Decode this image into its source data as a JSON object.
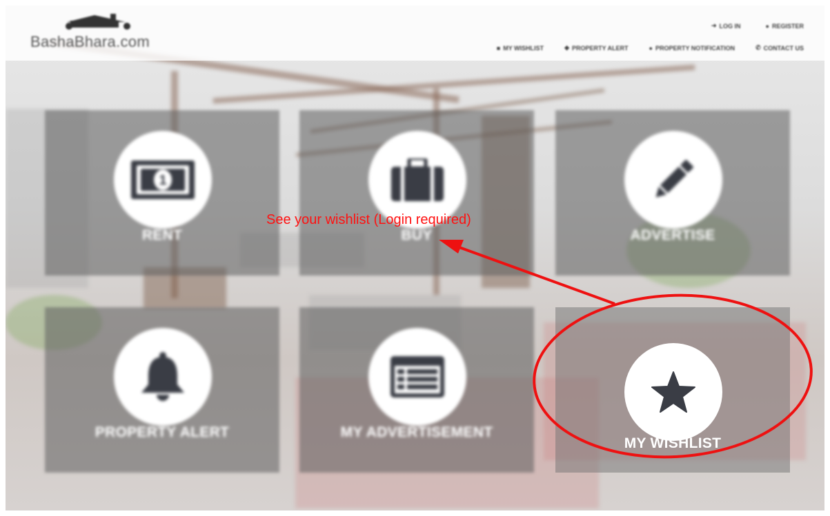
{
  "header": {
    "logo_text": "BashaBhara.com",
    "top_links": [
      {
        "label": "LOG IN",
        "icon": "login-icon"
      },
      {
        "label": "REGISTER",
        "icon": "user-icon"
      }
    ],
    "nav_links": [
      {
        "label": "MY WISHLIST",
        "icon": "list-icon"
      },
      {
        "label": "PROPERTY ALERT",
        "icon": "alert-icon"
      },
      {
        "label": "PROPERTY NOTIFICATION",
        "icon": "notification-icon"
      },
      {
        "label": "CONTACT US",
        "icon": "phone-icon"
      }
    ]
  },
  "tiles": [
    {
      "label": "RENT",
      "icon": "money-icon"
    },
    {
      "label": "BUY",
      "icon": "briefcase-icon"
    },
    {
      "label": "ADVERTISE",
      "icon": "pencil-icon"
    },
    {
      "label": "PROPERTY ALERT",
      "icon": "bell-icon"
    },
    {
      "label": "MY ADVERTISEMENT",
      "icon": "list-card-icon"
    },
    {
      "label": "MY WISHLIST",
      "icon": "star-icon"
    }
  ],
  "annotation": {
    "text": "See your wishlist (Login required)",
    "color": "#ff1111"
  },
  "colors": {
    "tile_bg": "#5f5f5f",
    "icon_dark": "#3a3d45",
    "annotation_red": "#ff1111"
  }
}
